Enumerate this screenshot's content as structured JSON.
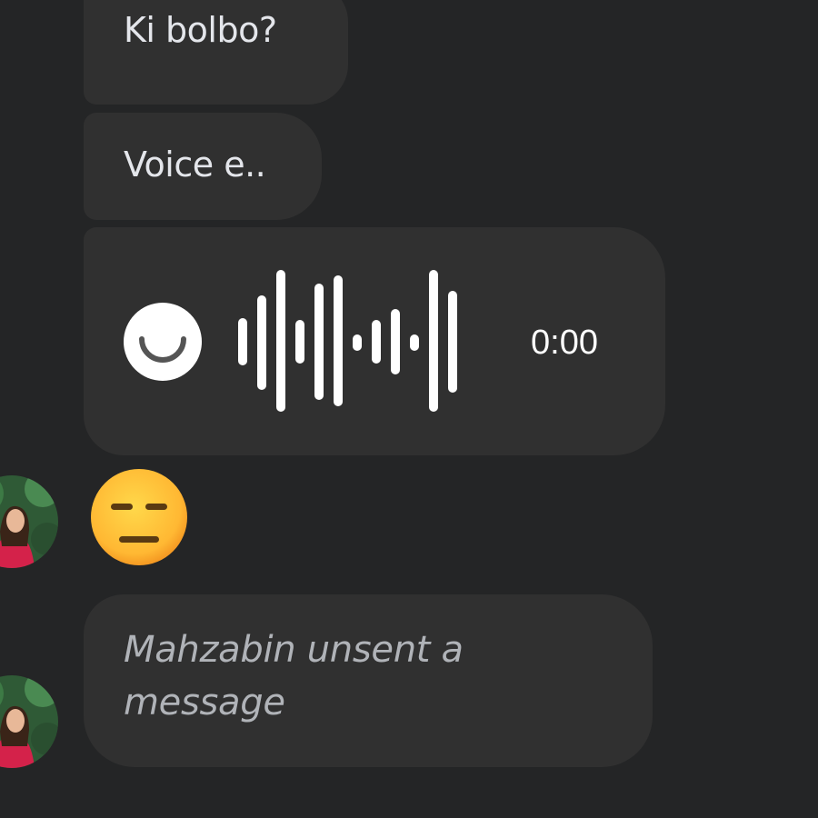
{
  "messages": {
    "msg1": {
      "text": "Ki bolbo?"
    },
    "msg2": {
      "text": "Voice e.."
    },
    "voice": {
      "duration": "0:00",
      "state_icon": "loading-icon"
    },
    "emoji": {
      "glyph": "😑",
      "icon": "expressionless-face-emoji"
    },
    "unsent": {
      "text": "Mahzabin unsent a message"
    }
  },
  "avatars": [
    {
      "icon": "avatar"
    },
    {
      "icon": "avatar"
    }
  ],
  "colors": {
    "background": "#242526",
    "bubble": "#303030",
    "text": "#e4e6eb",
    "muted_text": "#b0b3b8",
    "accent": "#ffffff"
  }
}
